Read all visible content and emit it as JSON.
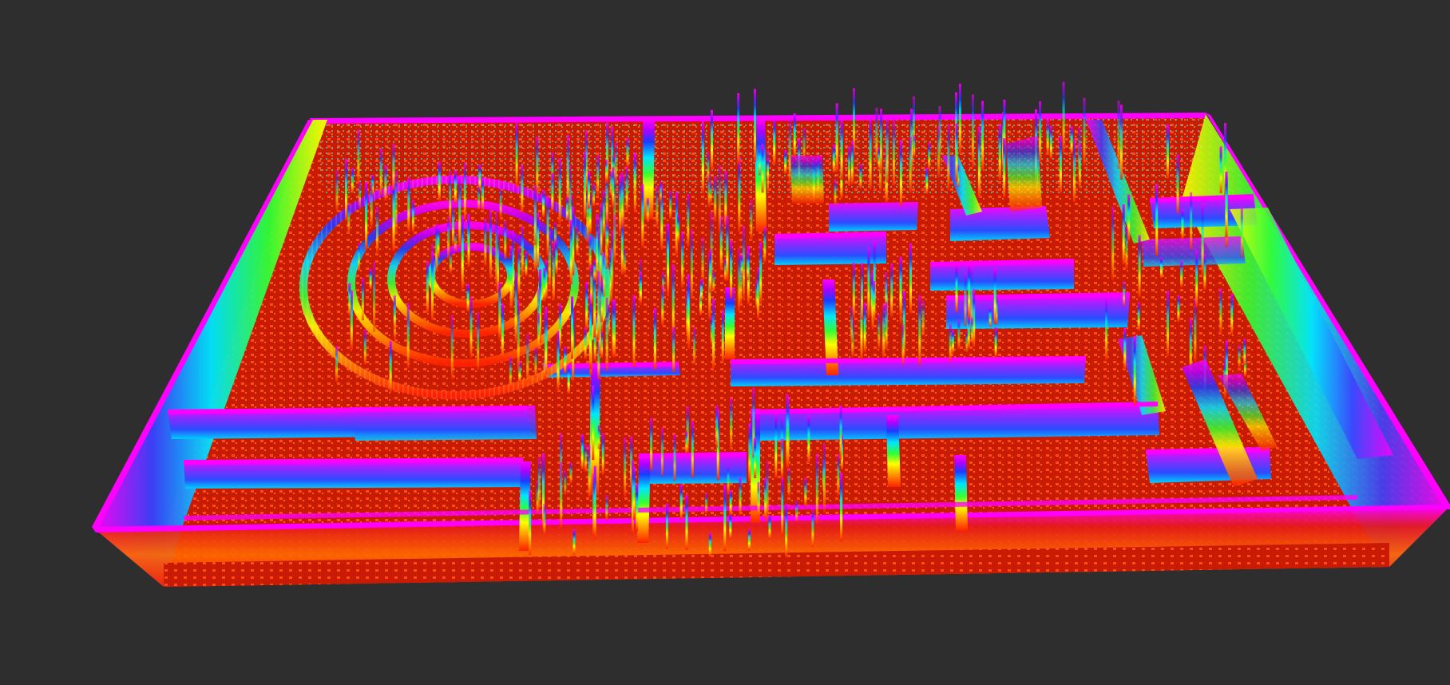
{
  "viewer": {
    "background_color": "#2e2e2e",
    "view_mode": "3d-orbit"
  },
  "octomap": {
    "display_type": "occupancy-voxels",
    "color_mode": "height-rainbow",
    "floor_color": "#d81e05",
    "floor_dot_color": "#ffb000",
    "top_color": "#ff00ff",
    "height_gradient": [
      "#ff2000",
      "#ff9900",
      "#ffff00",
      "#33ff33",
      "#00e5ff",
      "#1a3cff",
      "#b200ff",
      "#ff00ff"
    ]
  }
}
